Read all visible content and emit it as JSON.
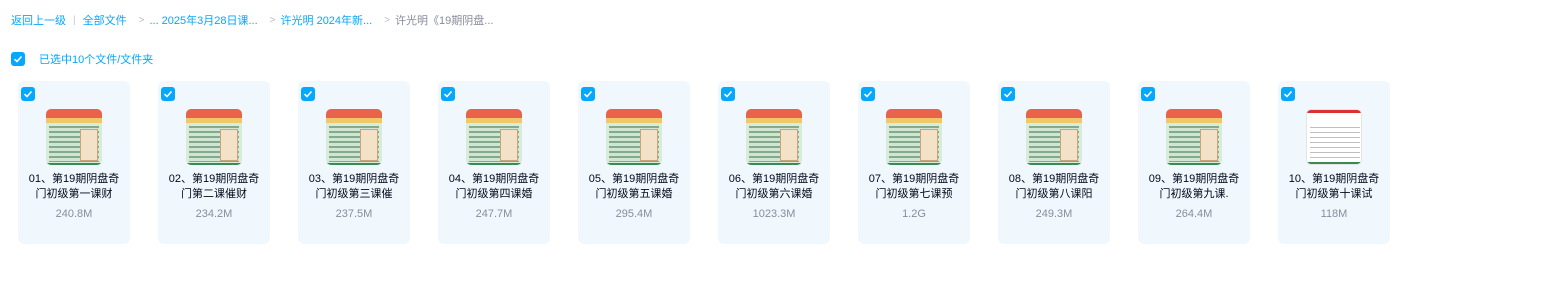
{
  "breadcrumb": {
    "back_label": "返回上一级",
    "all_files_label": "全部文件",
    "path": [
      "... 2025年3月28日课...",
      "许光明 2024年新...",
      "许光明《19期阴盘..."
    ]
  },
  "selection": {
    "label": "已选中10个文件/文件夹"
  },
  "files": [
    {
      "name": "01、第19期阴盘奇门初级第一课财",
      "size": "240.8M",
      "thumb": "chart"
    },
    {
      "name": "02、第19期阴盘奇门第二课催财",
      "size": "234.2M",
      "thumb": "chart"
    },
    {
      "name": "03、第19期阴盘奇门初级第三课催",
      "size": "237.5M",
      "thumb": "chart"
    },
    {
      "name": "04、第19期阴盘奇门初级第四课婚",
      "size": "247.7M",
      "thumb": "chart"
    },
    {
      "name": "05、第19期阴盘奇门初级第五课婚",
      "size": "295.4M",
      "thumb": "chart"
    },
    {
      "name": "06、第19期阴盘奇门初级第六课婚",
      "size": "1023.3M",
      "thumb": "chart"
    },
    {
      "name": "07、第19期阴盘奇门初级第七课预",
      "size": "1.2G",
      "thumb": "chart"
    },
    {
      "name": "08、第19期阴盘奇门初级第八课阳",
      "size": "249.3M",
      "thumb": "chart"
    },
    {
      "name": "09、第19期阴盘奇门初级第九课.",
      "size": "264.4M",
      "thumb": "chart"
    },
    {
      "name": "10、第19期阴盘奇门初级第十课试",
      "size": "118M",
      "thumb": "white"
    }
  ]
}
